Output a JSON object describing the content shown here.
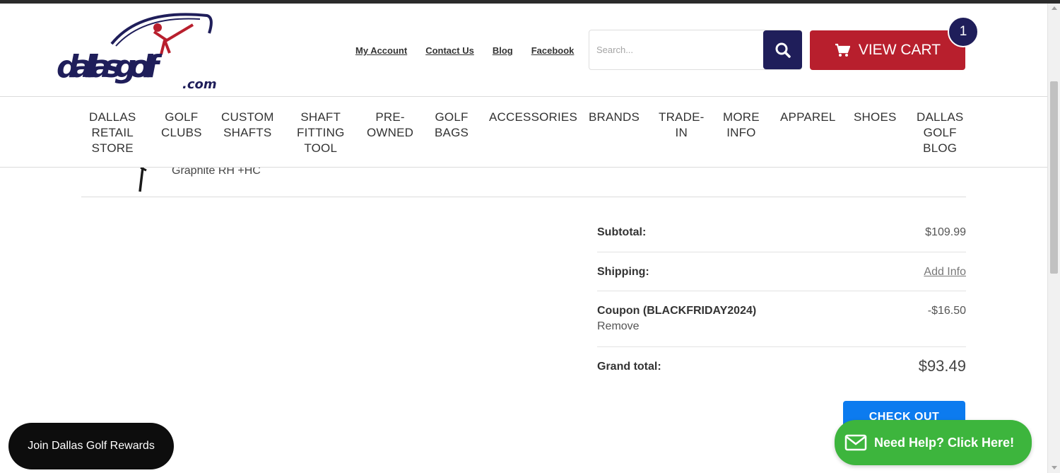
{
  "header": {
    "logo_main": "dallasgolf",
    "logo_sub": ".com",
    "links": [
      "My Account",
      "Contact Us",
      "Blog",
      "Facebook"
    ],
    "search_placeholder": "Search...",
    "cart_label": "VIEW CART",
    "cart_count": "1"
  },
  "nav": {
    "items": [
      "DALLAS\nRETAIL\nSTORE",
      "GOLF\nCLUBS",
      "CUSTOM\nSHAFTS",
      "SHAFT\nFITTING\nTOOL",
      "PRE-\nOWNED",
      "GOLF\nBAGS",
      "ACCESSORIES",
      "BRANDS",
      "TRADE-\nIN",
      "MORE\nINFO",
      "APPAREL",
      "SHOES",
      "DALLAS\nGOLF\nBLOG"
    ]
  },
  "cart_item": {
    "variant": "Graphite RH +HC"
  },
  "totals": {
    "subtotal_label": "Subtotal:",
    "subtotal_value": "$109.99",
    "shipping_label": "Shipping:",
    "shipping_value": "Add Info",
    "coupon_label": "Coupon (BLACKFRIDAY2024)",
    "coupon_value": "-$16.50",
    "coupon_remove": "Remove",
    "grand_label": "Grand total:",
    "grand_value": "$93.49"
  },
  "checkout_label": "CHECK OUT",
  "rewards_label": "Join Dallas Golf Rewards",
  "help_label": "Need Help? Click Here!",
  "colors": {
    "navy": "#1f1e5a",
    "cart_red": "#b81f2d",
    "checkout_blue": "#0c7bef",
    "help_green": "#3db53d"
  }
}
